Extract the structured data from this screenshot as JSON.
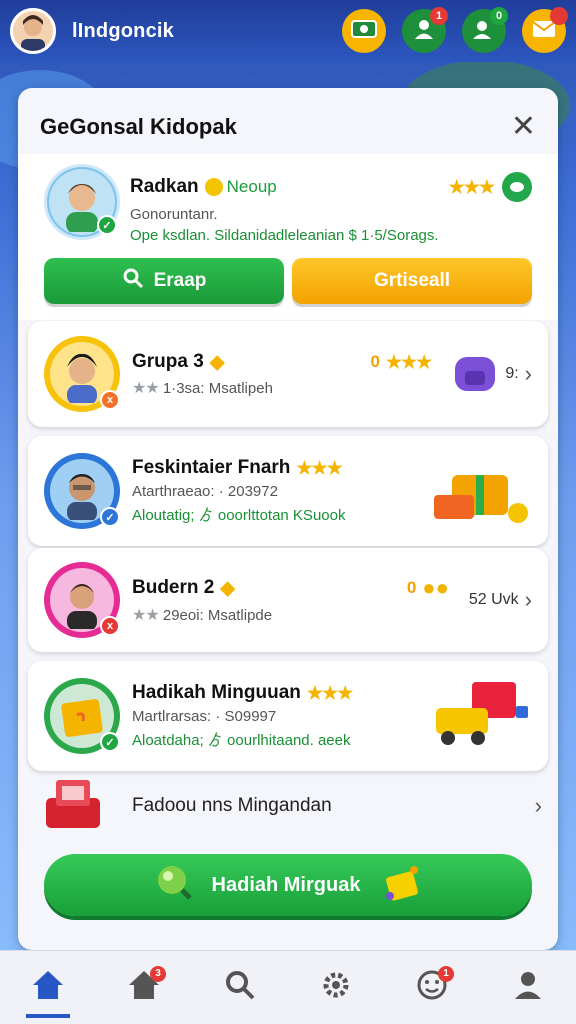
{
  "header": {
    "username": "lIndgoncik",
    "badges": {
      "friends": "1",
      "groups": "0"
    }
  },
  "panel": {
    "title": "GeGonsal Kidopak",
    "featured": {
      "name": "Radkan",
      "status": "Neoup",
      "subtitle": "Gonoruntanr.",
      "detail": "Ope ksdlan. Sildanidadleleanian $ 1·5/Sorags."
    },
    "buttons": {
      "search_label": "Eraap",
      "gift_label": "Grtiseall"
    },
    "cards": [
      {
        "title": "Grupa 3",
        "prefix": "0",
        "sub": "1·3sa:  Msatlipeh",
        "right": "9:"
      },
      {
        "title": "Feskintaier Fnarh",
        "sub": "Atarthraeao: · 203972",
        "green": "Aloutatig; ゟ ooorlttotan KSuook"
      },
      {
        "title": "Budern 2",
        "prefix": "0",
        "sub": "29eoi:  Msatlipde",
        "right": "52 Uvk"
      },
      {
        "title": "Hadikah Minguuan",
        "sub": "Martlrarsas: · S09997",
        "green": "Aloatdaha; ゟ oourlhitaand. aeek"
      }
    ],
    "promo_row_label": "Fadoou nns Mingandan",
    "main_cta_label": "Hadiah Mirguak"
  },
  "colors": {
    "accent_green": "#1fa640",
    "accent_orange": "#f5a800",
    "nav_active": "#2756c5",
    "badge_red": "#e53935"
  },
  "bottom_nav": {
    "items": [
      "home-icon",
      "store-icon",
      "search-icon",
      "settings-icon",
      "emoji-icon",
      "profile-icon"
    ],
    "badges": {
      "store": "3",
      "emoji": "1"
    }
  }
}
